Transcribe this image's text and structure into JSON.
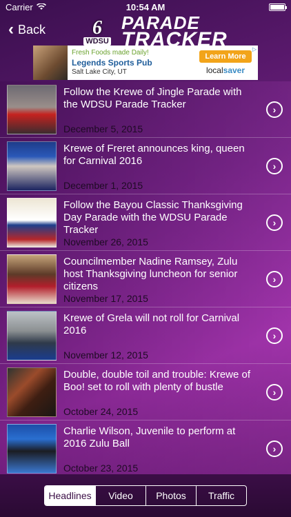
{
  "status": {
    "carrier": "Carrier",
    "time": "10:54 AM"
  },
  "nav": {
    "back_label": "Back",
    "logo_six": "6",
    "logo_station": "WDSU",
    "logo_line1": "PARADE",
    "logo_line2": "TRACKER"
  },
  "ad": {
    "line1": "Fresh Foods made Daily!",
    "line2": "Legends Sports Pub",
    "line3": "Salt Lake City, UT",
    "button": "Learn More",
    "brand_a": "local",
    "brand_b": "saver"
  },
  "items": [
    {
      "title": "Follow the Krewe of Jingle Parade with the WDSU Parade Tracker",
      "date": "December 5, 2015"
    },
    {
      "title": "Krewe of Freret announces king, queen for Carnival 2016",
      "date": "December 1, 2015"
    },
    {
      "title": "Follow the Bayou Classic Thanksgiving Day Parade with the WDSU Parade Tracker",
      "date": "November 26, 2015"
    },
    {
      "title": "Councilmember Nadine Ramsey, Zulu host Thanksgiving luncheon for senior citizens",
      "date": "November 17, 2015"
    },
    {
      "title": "Krewe of Grela will not roll for Carnival 2016",
      "date": "November 12, 2015"
    },
    {
      "title": "Double, double toil and trouble: Krewe of Boo! set to roll with plenty of bustle",
      "date": "October 24, 2015"
    },
    {
      "title": "Charlie Wilson, Juvenile to perform at 2016 Zulu Ball",
      "date": "October 23, 2015"
    }
  ],
  "tabs": [
    "Headlines",
    "Video",
    "Photos",
    "Traffic"
  ]
}
